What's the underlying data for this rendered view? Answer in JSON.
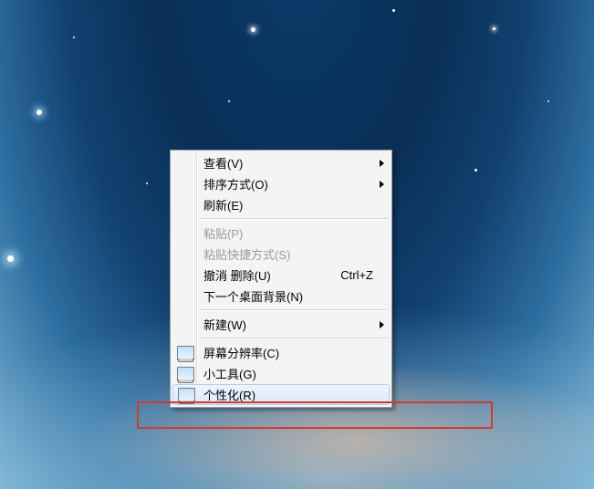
{
  "menu": {
    "groups": [
      [
        {
          "key": "view",
          "label": "查看(V)",
          "submenu": true
        },
        {
          "key": "sort",
          "label": "排序方式(O)",
          "submenu": true
        },
        {
          "key": "refresh",
          "label": "刷新(E)"
        }
      ],
      [
        {
          "key": "paste",
          "label": "粘贴(P)",
          "disabled": true
        },
        {
          "key": "paste-shortcut",
          "label": "粘贴快捷方式(S)",
          "disabled": true
        },
        {
          "key": "undo-delete",
          "label": "撤消 删除(U)",
          "shortcut": "Ctrl+Z"
        },
        {
          "key": "next-bg",
          "label": "下一个桌面背景(N)"
        }
      ],
      [
        {
          "key": "new",
          "label": "新建(W)",
          "submenu": true
        }
      ],
      [
        {
          "key": "resolution",
          "label": "屏幕分辨率(C)",
          "icon": true
        },
        {
          "key": "gadgets",
          "label": "小工具(G)",
          "icon": true
        },
        {
          "key": "personalize",
          "label": "个性化(R)",
          "icon": true,
          "selected": true
        }
      ]
    ]
  }
}
